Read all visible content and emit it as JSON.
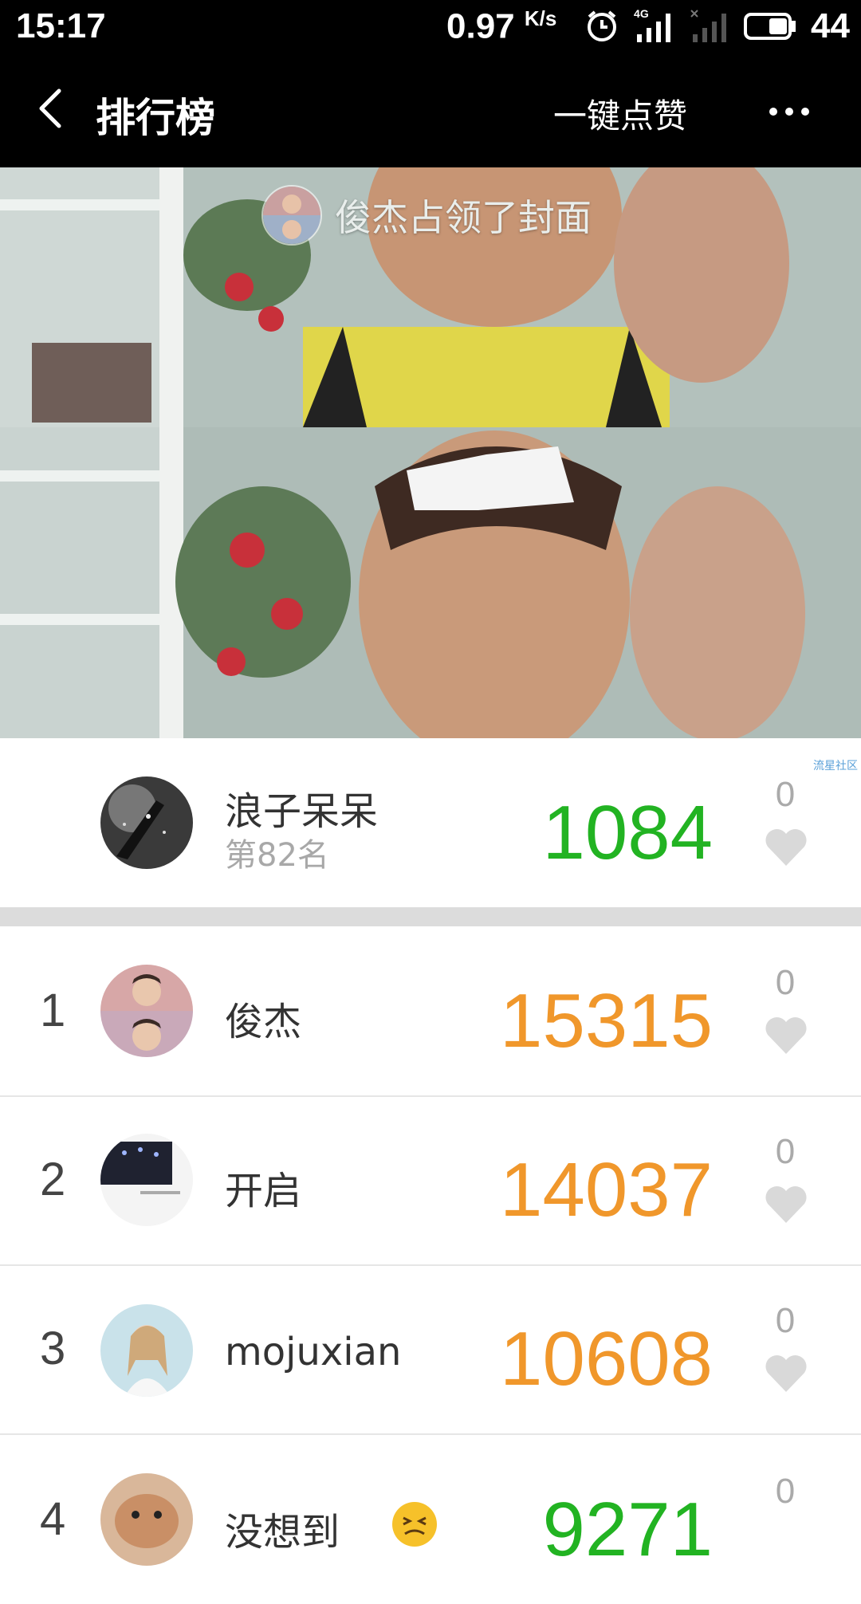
{
  "status_bar": {
    "time": "15:17",
    "speed": "0.97",
    "speed_unit": "K/s",
    "network": "4G",
    "battery": "44"
  },
  "nav": {
    "title": "排行榜",
    "like_all": "一键点赞"
  },
  "cover": {
    "caption": "俊杰占领了封面"
  },
  "my_rank": {
    "name": "浪子呆呆",
    "position": "第82名",
    "score": "1084",
    "likes": "0"
  },
  "watermark": "流星社区",
  "leaderboard": [
    {
      "rank": "1",
      "name": "俊杰",
      "score": "15315",
      "likes": "0"
    },
    {
      "rank": "2",
      "name": "开启",
      "score": "14037",
      "likes": "0"
    },
    {
      "rank": "3",
      "name": "mojuxian",
      "score": "10608",
      "likes": "0"
    },
    {
      "rank": "4",
      "name": "没想到",
      "score": "9271",
      "likes": "0"
    }
  ],
  "colors": {
    "score_top": "#f0972b",
    "score_other": "#22b322",
    "heart": "#d9d9d9"
  }
}
